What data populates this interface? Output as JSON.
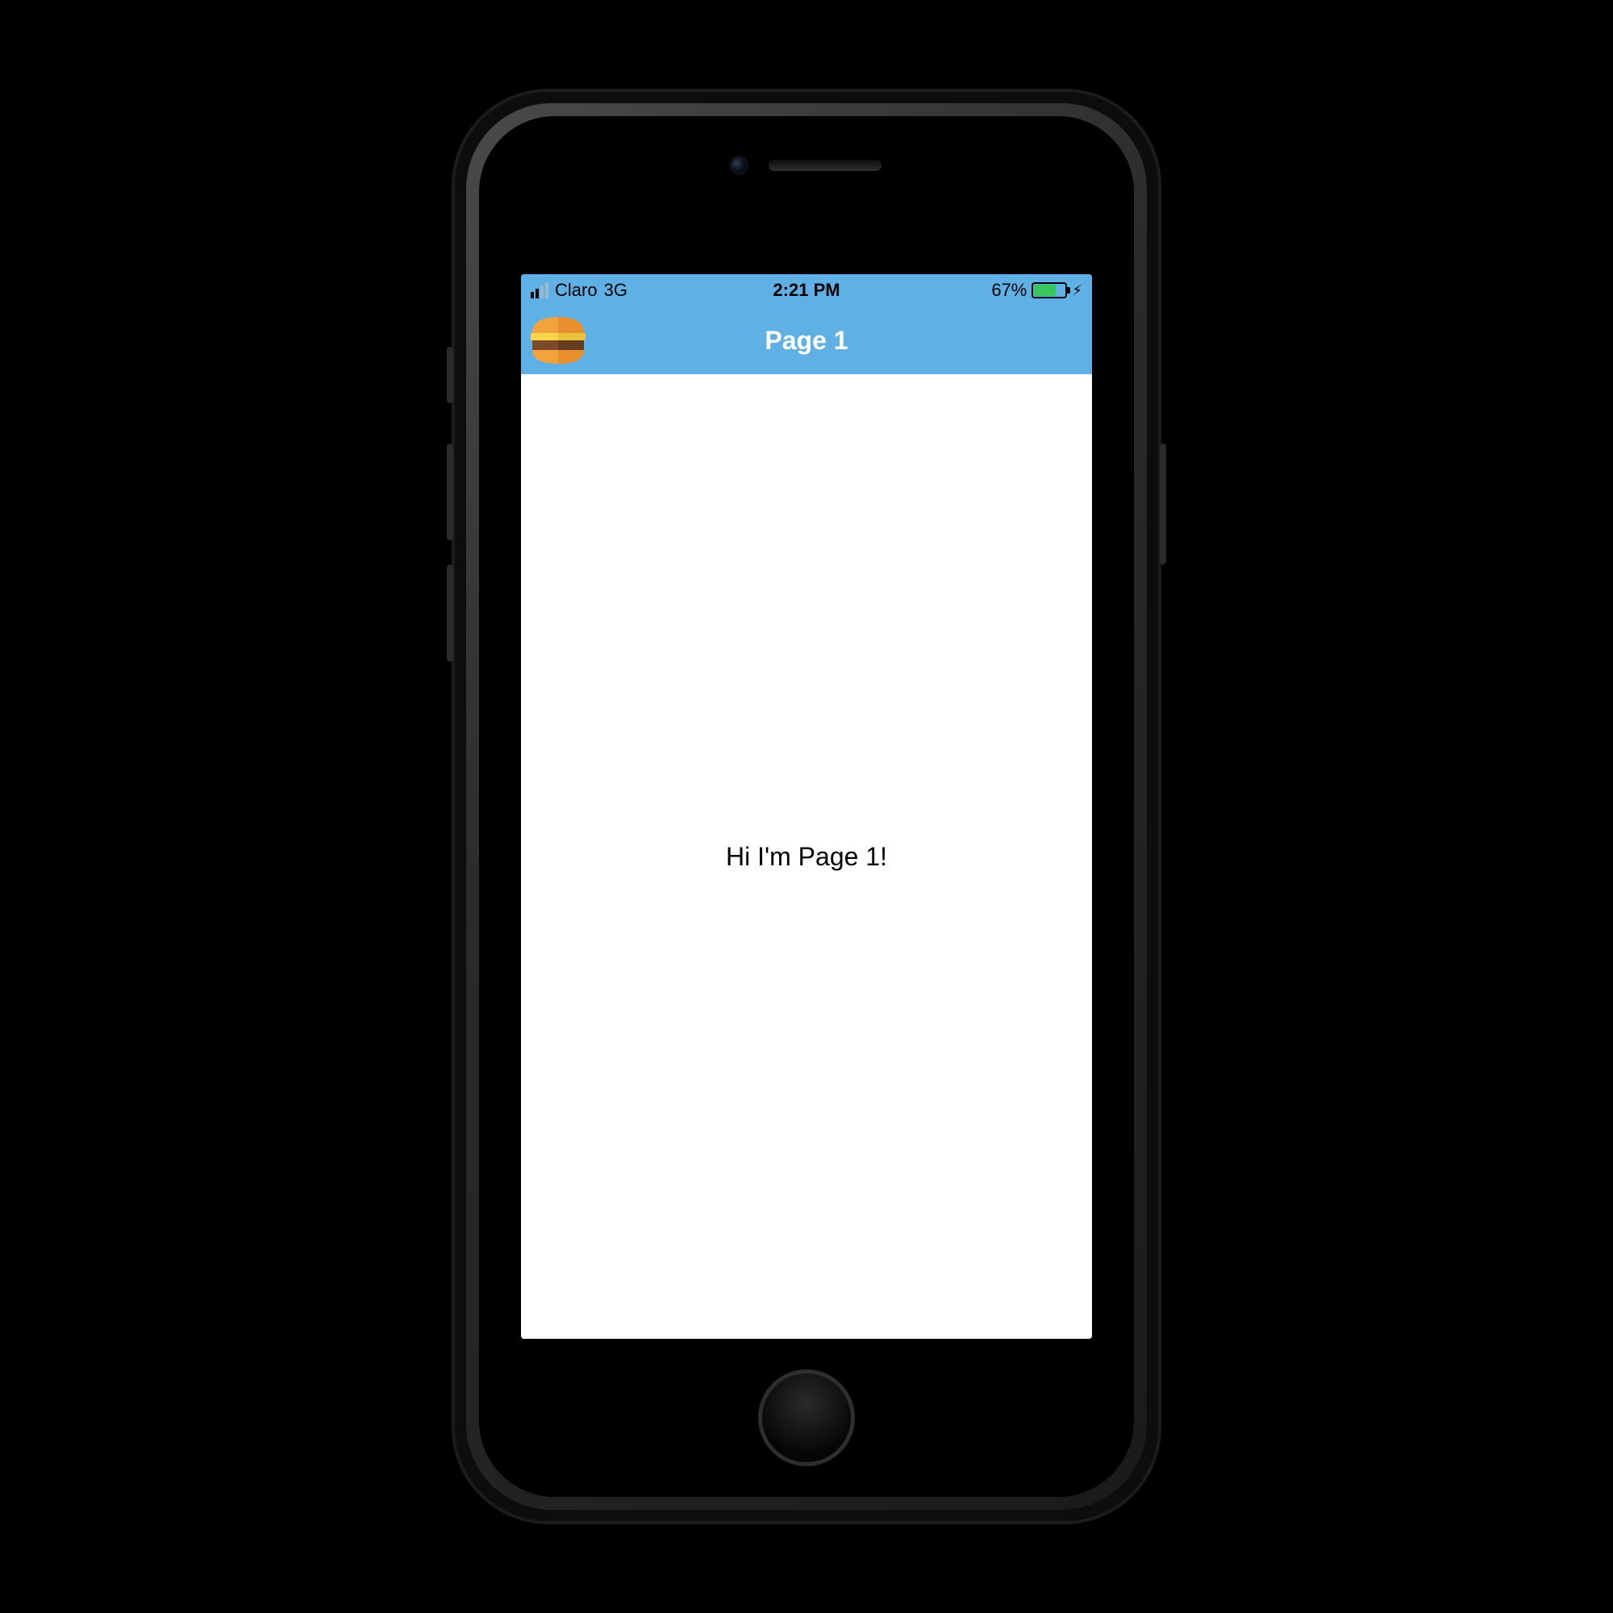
{
  "status_bar": {
    "carrier": "Claro",
    "network": "3G",
    "time": "2:21 PM",
    "battery_percent_label": "67%",
    "battery_fill_percent": 67
  },
  "nav": {
    "title": "Page 1",
    "menu_icon_name": "hamburger-icon"
  },
  "main": {
    "body_text": "Hi I'm Page 1!"
  },
  "colors": {
    "accent": "#5fb1e5",
    "battery_green": "#35c759"
  }
}
